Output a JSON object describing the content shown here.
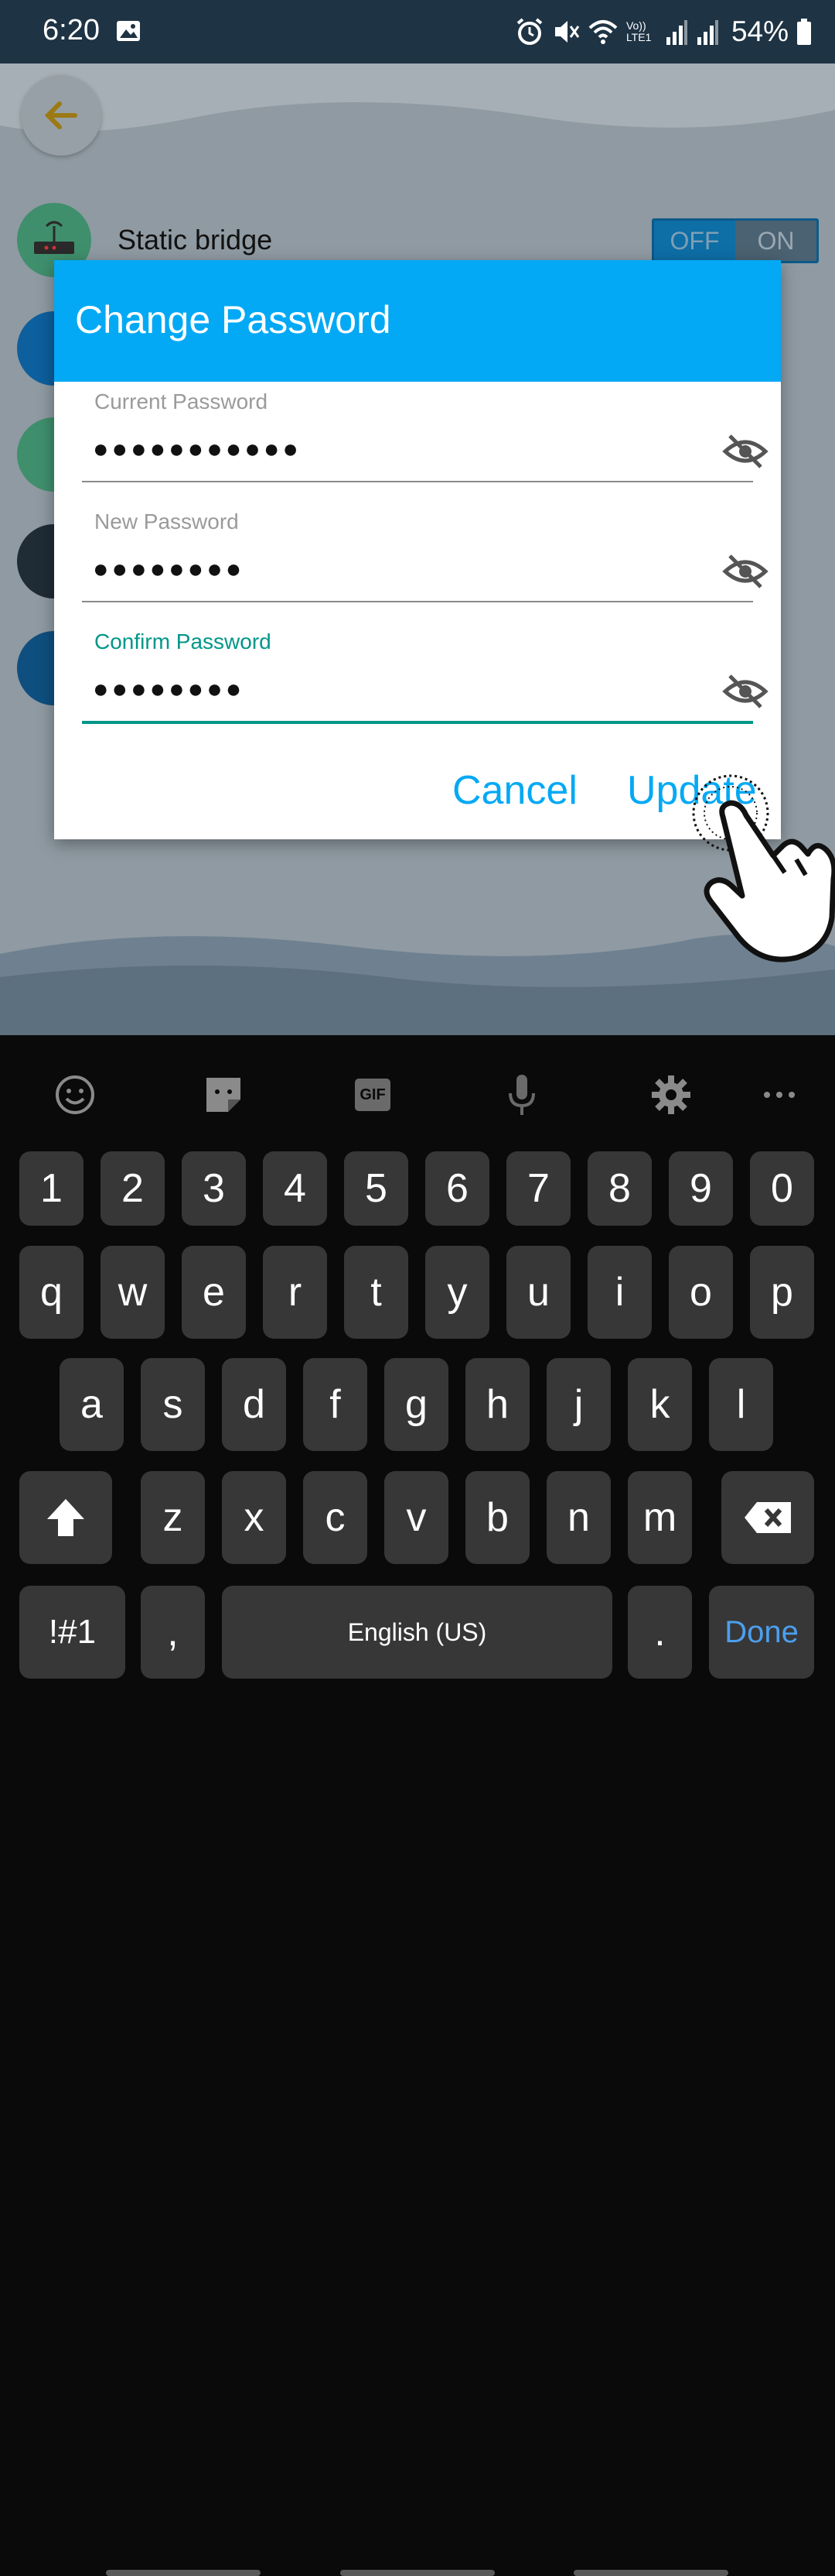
{
  "status_bar": {
    "time": "6:20",
    "battery": "54%",
    "volte_label": "Vo)) LTE1"
  },
  "background": {
    "back_button_icon": "arrow-left-icon",
    "items": [
      {
        "icon": "router-icon",
        "label": "Static bridge"
      },
      {
        "icon": "settings-icon",
        "label": ""
      },
      {
        "icon": "lock-icon",
        "label": ""
      },
      {
        "icon": "plus-icon",
        "label": ""
      },
      {
        "icon": "password-lock-icon",
        "label": ""
      }
    ],
    "toggle": {
      "off_label": "OFF",
      "on_label": "ON",
      "state": "on"
    }
  },
  "dialog": {
    "title": "Change Password",
    "fields": [
      {
        "label": "Current Password",
        "value": "●●●●●●●●●●●",
        "icon": "eye-off-icon",
        "focused": false
      },
      {
        "label": "New Password",
        "value": "●●●●●●●●",
        "icon": "eye-off-icon",
        "focused": false
      },
      {
        "label": "Confirm Password",
        "value": "●●●●●●●●",
        "icon": "eye-off-icon",
        "focused": true
      }
    ],
    "cancel_label": "Cancel",
    "update_label": "Update"
  },
  "keyboard": {
    "toolbar": [
      "emoji-icon",
      "sticker-icon",
      "gif-icon",
      "microphone-icon",
      "settings-icon",
      "more-icon"
    ],
    "gif_label": "GIF",
    "rows": [
      [
        "1",
        "2",
        "3",
        "4",
        "5",
        "6",
        "7",
        "8",
        "9",
        "0"
      ],
      [
        "q",
        "w",
        "e",
        "r",
        "t",
        "y",
        "u",
        "i",
        "o",
        "p"
      ],
      [
        "a",
        "s",
        "d",
        "f",
        "g",
        "h",
        "j",
        "k",
        "l"
      ],
      [
        "z",
        "x",
        "c",
        "v",
        "b",
        "n",
        "m"
      ]
    ],
    "symbols_label": "!#1",
    "comma_label": ",",
    "space_label": "English (US)",
    "period_label": ".",
    "done_label": "Done"
  },
  "colors": {
    "dialog_header": "#03a9f4",
    "accent_teal": "#009688",
    "button_blue": "#03a9f4",
    "done_blue": "#4c9fee"
  }
}
